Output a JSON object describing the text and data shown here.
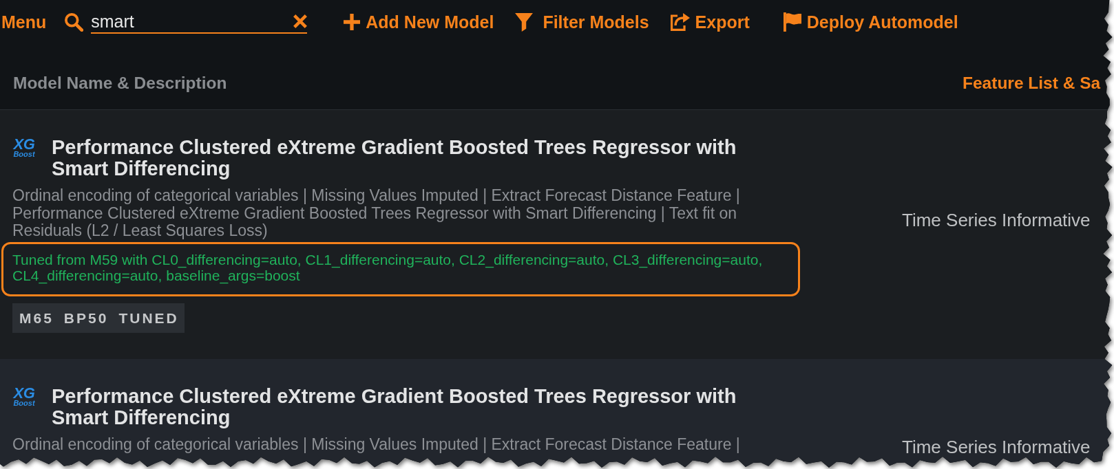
{
  "toolbar": {
    "menu_label": "Menu",
    "search": {
      "value": "smart"
    },
    "actions": [
      {
        "kind": "add",
        "label": "Add New Model"
      },
      {
        "kind": "filter",
        "label": "Filter Models"
      },
      {
        "kind": "export",
        "label": "Export"
      },
      {
        "kind": "deploy",
        "label": "Deploy Automodel"
      }
    ]
  },
  "table": {
    "columns": [
      {
        "label": "Model Name & Description",
        "sorted": false
      },
      {
        "label": "Feature List & Sa",
        "sorted": true
      }
    ],
    "rows": [
      {
        "logo": {
          "line_1": "XG",
          "line_2": "Boost"
        },
        "title": "Performance Clustered eXtreme Gradient Boosted Trees Regressor with Smart Differencing",
        "description": "Ordinal encoding of categorical variables | Missing Values Imputed | Extract Forecast Distance Feature | Performance Clustered eXtreme Gradient Boosted Trees Regressor with Smart Differencing | Text fit on Residuals (L2 / Least Squares Loss)",
        "tuning_note": {
          "text": "Tuned from M59 with CL0_differencing=auto, CL1_differencing=auto, CL2_differencing=auto, CL3_differencing=auto, CL4_differencing=auto, baseline_args=boost",
          "highlighted": true
        },
        "badges": [
          "M65",
          "BP50",
          "TUNED"
        ],
        "feature_list": "Time Series Informative"
      },
      {
        "logo": {
          "line_1": "XG",
          "line_2": "Boost"
        },
        "title": "Performance Clustered eXtreme Gradient Boosted Trees Regressor with Smart Differencing",
        "description": "Ordinal encoding of categorical variables | Missing Values Imputed | Extract Forecast Distance Feature |",
        "feature_list": "Time Series Informative"
      }
    ]
  }
}
